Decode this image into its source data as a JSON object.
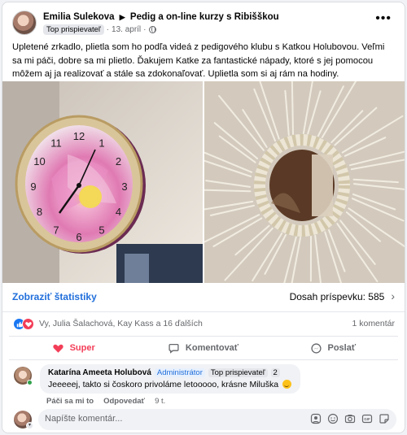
{
  "post": {
    "author": "Emilia Sulekova",
    "arrow": "▶",
    "group": "Pedig a on-line kurzy s Ribišškou",
    "badge": "Top prispievateľ",
    "date": "13. apríl",
    "more": "•••",
    "text": "Upletené zrkadlo, plietla som ho podľa videá z pedigového klubu s Katkou Holubovou. Veľmi sa mi páči, dobre sa mi plietlo. Ďakujem Katke za fantastické nápady, ktoré s jej pomocou môžem aj ja realizovať a stále sa zdokonaľovať. Uplietla som si aj rám na hodiny."
  },
  "clock_numbers": [
    "12",
    "1",
    "2",
    "3",
    "4",
    "5",
    "6",
    "7",
    "8",
    "9",
    "10",
    "11"
  ],
  "stats": {
    "link": "Zobraziť štatistiky",
    "reach": "Dosah príspevku: 585"
  },
  "reactions": {
    "names": "Vy, Julia Šalachová, Kay Kass a 16 ďalších",
    "comments": "1 komentár"
  },
  "actions": {
    "super": "Super",
    "comment": "Komentovať",
    "share": "Poslať"
  },
  "comment": {
    "author": "Katarína Ameeta Holubová",
    "admin_badge": "Administrátor",
    "top_badge": "Top prispievateľ",
    "badge_count": "2",
    "text": "Jeeeeej, takto si čoskoro privoláme letooooo, krásne Miluška",
    "like": "Páči sa mi to",
    "reply": "Odpovedať",
    "time": "9 t."
  },
  "composer": {
    "placeholder": "Napíšte komentár..."
  },
  "colors": {
    "link": "#216fdb",
    "love": "#f33e58",
    "like": "#1877f2"
  }
}
